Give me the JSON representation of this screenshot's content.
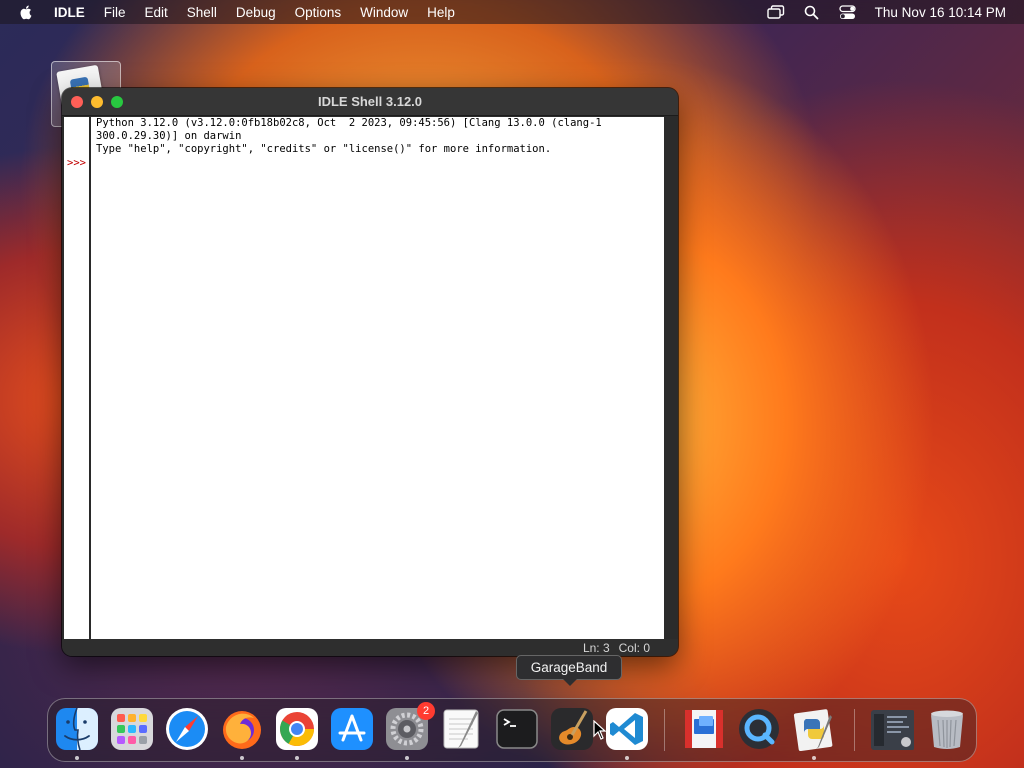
{
  "menubar": {
    "apple_icon": "apple-logo-icon",
    "app_name": "IDLE",
    "items": [
      "File",
      "Edit",
      "Shell",
      "Debug",
      "Options",
      "Window",
      "Help"
    ],
    "status_icons": [
      "screen-mirroring-icon",
      "spotlight-search-icon",
      "control-center-icon"
    ],
    "clock": "Thu Nov 16  10:14 PM"
  },
  "window": {
    "title": "IDLE Shell 3.12.0",
    "lines": [
      "Python 3.12.0 (v3.12.0:0fb18b02c8, Oct  2 2023, 09:45:56) [Clang 13.0.0 (clang-1",
      "300.0.29.30)] on darwin",
      "Type \"help\", \"copyright\", \"credits\" or \"license()\" for more information."
    ],
    "prompt": ">>>",
    "status_ln": "Ln: 3",
    "status_col": "Col: 0"
  },
  "tooltip": {
    "text": "GarageBand"
  },
  "dock": {
    "items": [
      {
        "name": "finder",
        "icon": "finder-icon",
        "running": true
      },
      {
        "name": "launchpad",
        "icon": "launchpad-icon",
        "running": false
      },
      {
        "name": "safari",
        "icon": "safari-icon",
        "running": false
      },
      {
        "name": "firefox",
        "icon": "firefox-icon",
        "running": true
      },
      {
        "name": "chrome",
        "icon": "chrome-icon",
        "running": true
      },
      {
        "name": "app-store",
        "icon": "app-store-icon",
        "running": false
      },
      {
        "name": "system-settings",
        "icon": "system-settings-icon",
        "running": true,
        "badge": "2"
      },
      {
        "name": "textedit",
        "icon": "textedit-icon",
        "running": false
      },
      {
        "name": "terminal",
        "icon": "terminal-icon",
        "running": false
      },
      {
        "name": "garageband",
        "icon": "garageband-icon",
        "running": false
      },
      {
        "name": "vscode",
        "icon": "vscode-icon",
        "running": true
      },
      {
        "name": "remote-desktop",
        "icon": "remote-desktop-icon",
        "running": false
      },
      {
        "name": "quicktime",
        "icon": "quicktime-icon",
        "running": false
      },
      {
        "name": "python-launcher",
        "icon": "python-launcher-icon",
        "running": true
      },
      {
        "name": "recent-window",
        "icon": "window-thumbnail-icon",
        "running": false
      },
      {
        "name": "trash",
        "icon": "trash-icon",
        "running": false
      }
    ]
  },
  "colors": {
    "prompt": "#c00000",
    "close": "#ff5f57",
    "minimize": "#febc2e",
    "zoom": "#28c840",
    "badge": "#ff3b30"
  }
}
